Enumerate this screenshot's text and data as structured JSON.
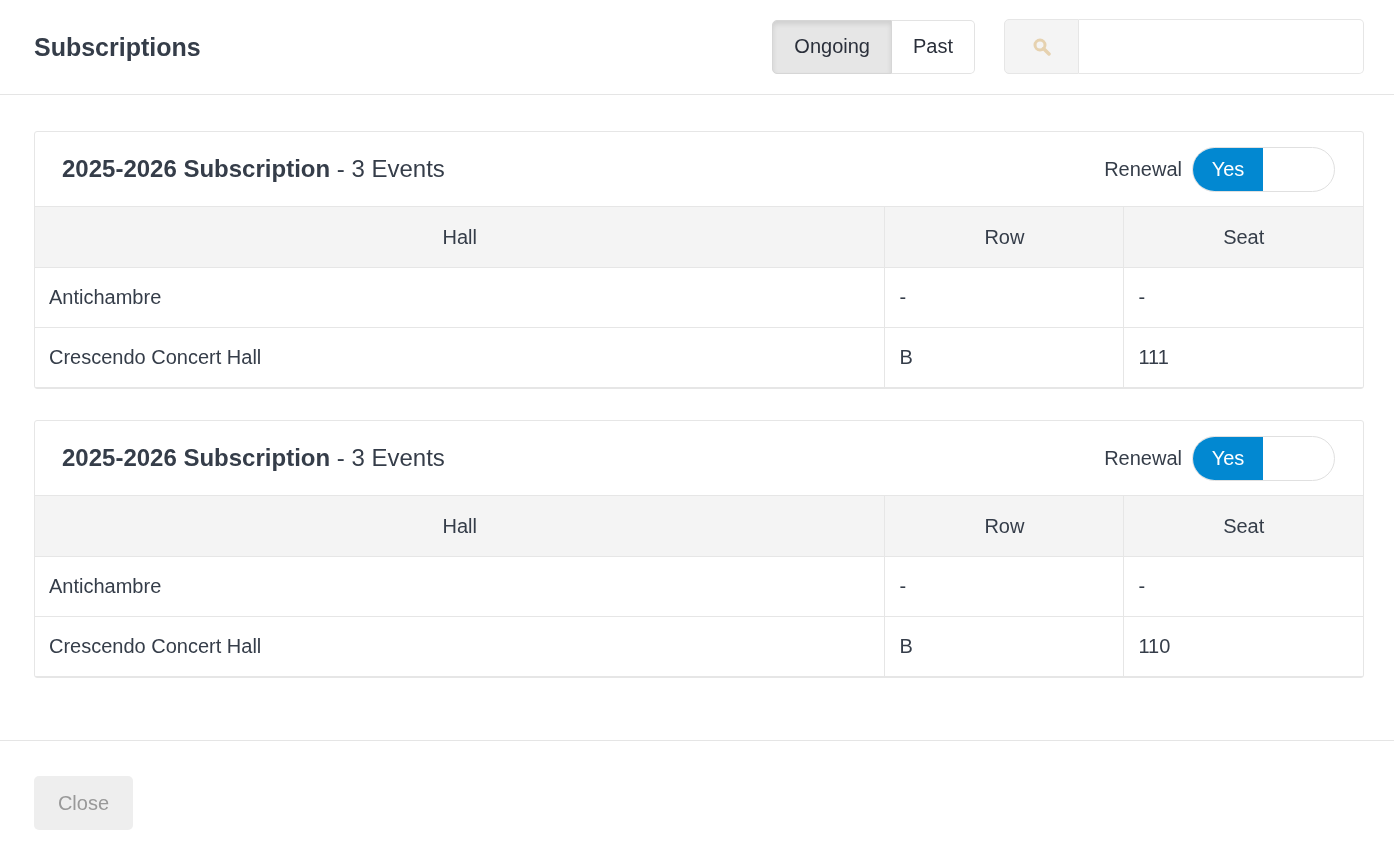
{
  "dialog": {
    "title": "Subscriptions"
  },
  "filter_tabs": [
    {
      "label": "Ongoing",
      "selected": true
    },
    {
      "label": "Past",
      "selected": false
    }
  ],
  "subscriptions": [
    {
      "title": "**2025-2026 Subscription** - 3 Events",
      "renewal": {
        "label": "Renewal",
        "on": true,
        "on_text": "Yes"
      },
      "table": {
        "columns": [
          "Hall",
          "Row",
          "Seat"
        ],
        "rows": [
          [
            "Antichambre",
            "-",
            "-"
          ],
          [
            "Crescendo Concert Hall",
            "B",
            "111"
          ]
        ]
      }
    },
    {
      "title": "**2025-2026 Subscription** - 3 Events",
      "renewal": {
        "label": "Renewal",
        "on": true,
        "on_text": "Yes"
      },
      "table": {
        "columns": [
          "Hall",
          "Row",
          "Seat"
        ],
        "rows": [
          [
            "Antichambre",
            "-",
            "-"
          ],
          [
            "Crescendo Concert Hall",
            "B",
            "110"
          ]
        ]
      }
    }
  ],
  "footer": {
    "buttons": [
      {
        "label": "Close",
        "disabled": true
      }
    ]
  }
}
